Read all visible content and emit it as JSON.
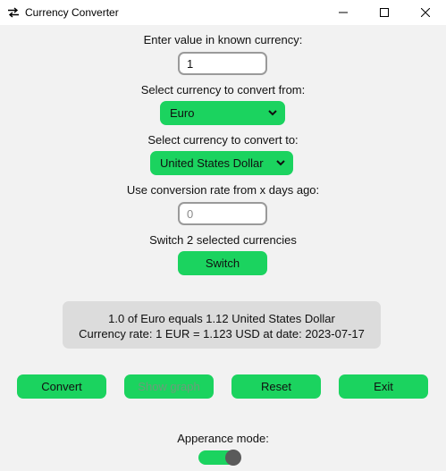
{
  "window": {
    "title": "Currency Converter",
    "icon": "exchange-arrows-icon"
  },
  "form": {
    "value_label": "Enter value in known currency:",
    "value": "1",
    "from_label": "Select currency to convert from:",
    "from_value": "Euro",
    "to_label": "Select currency to convert to:",
    "to_value": "United States Dollar",
    "days_label": "Use conversion rate from x days ago:",
    "days_placeholder": "0",
    "switch_label": "Switch 2 selected currencies",
    "switch_button": "Switch"
  },
  "result": {
    "line1": "1.0 of Euro equals 1.12 United States Dollar",
    "line2": "Currency rate: 1 EUR = 1.123 USD at date: 2023-07-17"
  },
  "actions": {
    "convert": "Convert",
    "show_graph": "Show graph",
    "reset": "Reset",
    "exit": "Exit"
  },
  "appearance": {
    "label": "Apperance mode:",
    "switch_on": true
  },
  "colors": {
    "accent": "#1bd35f",
    "background": "#f2f2f2",
    "result_box": "#dcdcdc",
    "knob": "#5a5a5a"
  }
}
